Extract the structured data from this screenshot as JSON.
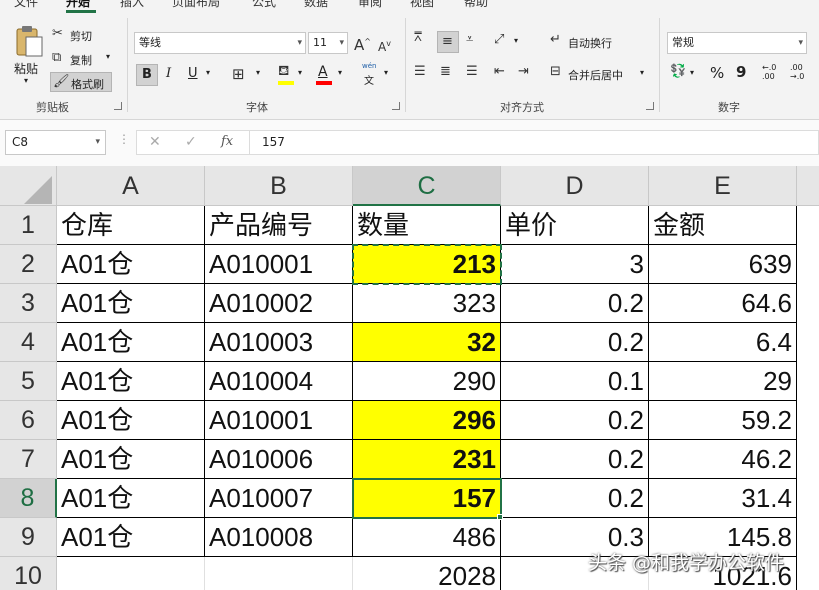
{
  "tabs": [
    "文件",
    "开始",
    "插入",
    "页面布局",
    "公式",
    "数据",
    "审阅",
    "视图",
    "帮助"
  ],
  "active_tab": "开始",
  "ribbon": {
    "clipboard": {
      "label": "剪贴板",
      "paste": "粘贴",
      "cut": "剪切",
      "copy": "复制",
      "format_painter": "格式刷"
    },
    "font": {
      "label": "字体",
      "font_name": "等线",
      "font_size": "11",
      "bold": "B",
      "italic": "I",
      "underline": "U",
      "grow": "A",
      "shrink": "A",
      "phonetic": "wén",
      "font_color_letter": "A",
      "fill_color": "#ffff00",
      "font_color": "#ff0000"
    },
    "alignment": {
      "label": "对齐方式",
      "wrap_text": "自动换行",
      "merge_center": "合并后居中"
    },
    "number": {
      "label": "数字",
      "format": "常规",
      "percent": "%",
      "comma": "9",
      "inc_decimal": "←.0\n.00",
      "dec_decimal": ".00\n→.0"
    }
  },
  "formula_bar": {
    "name_box": "C8",
    "value": "157",
    "fx": "fx"
  },
  "sheet": {
    "columns": [
      "A",
      "B",
      "C",
      "D",
      "E"
    ],
    "selected_column": "C",
    "selected_row": "8",
    "rows": [
      {
        "num": "1",
        "cells": [
          "仓库",
          "产品编号",
          "数量",
          "单价",
          "金额"
        ]
      },
      {
        "num": "2",
        "cells": [
          "A01仓",
          "A010001",
          "213",
          "3",
          "639"
        ]
      },
      {
        "num": "3",
        "cells": [
          "A01仓",
          "A010002",
          "323",
          "0.2",
          "64.6"
        ]
      },
      {
        "num": "4",
        "cells": [
          "A01仓",
          "A010003",
          "32",
          "0.2",
          "6.4"
        ]
      },
      {
        "num": "5",
        "cells": [
          "A01仓",
          "A010004",
          "290",
          "0.1",
          "29"
        ]
      },
      {
        "num": "6",
        "cells": [
          "A01仓",
          "A010001",
          "296",
          "0.2",
          "59.2"
        ]
      },
      {
        "num": "7",
        "cells": [
          "A01仓",
          "A010006",
          "231",
          "0.2",
          "46.2"
        ]
      },
      {
        "num": "8",
        "cells": [
          "A01仓",
          "A010007",
          "157",
          "0.2",
          "31.4"
        ]
      },
      {
        "num": "9",
        "cells": [
          "A01仓",
          "A010008",
          "486",
          "0.3",
          "145.8"
        ]
      },
      {
        "num": "10",
        "cells": [
          "",
          "",
          "2028",
          "",
          "1021.6"
        ]
      }
    ],
    "highlighted_rows": [
      "2",
      "4",
      "6",
      "7",
      "8"
    ],
    "highlight_color": "#ffff00",
    "selection_color": "#217346"
  },
  "watermark": "头条 @和我学办公软件"
}
